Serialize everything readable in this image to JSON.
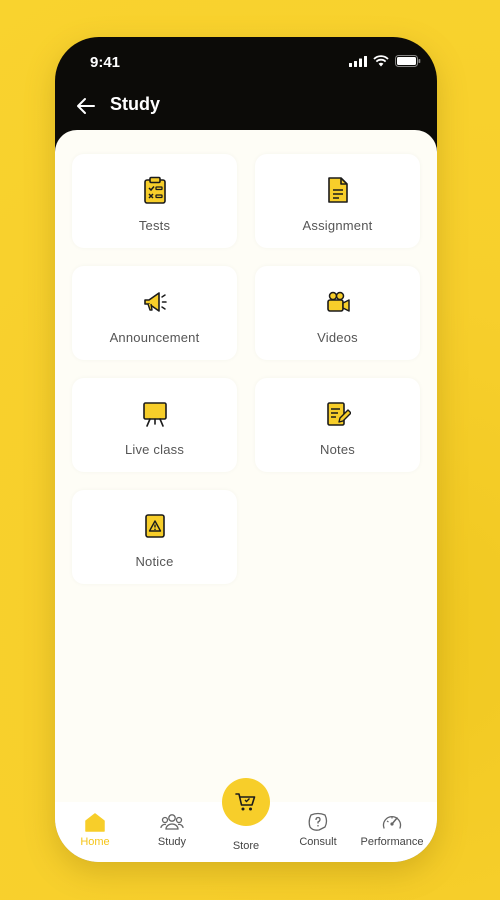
{
  "status_bar": {
    "time": "9:41"
  },
  "header": {
    "title": "Study"
  },
  "cards": [
    {
      "label": "Tests",
      "icon": "clipboard-checklist-icon"
    },
    {
      "label": "Assignment",
      "icon": "document-icon"
    },
    {
      "label": "Announcement",
      "icon": "megaphone-icon"
    },
    {
      "label": "Videos",
      "icon": "video-camera-icon"
    },
    {
      "label": "Live class",
      "icon": "easel-board-icon"
    },
    {
      "label": "Notes",
      "icon": "notes-pencil-icon"
    },
    {
      "label": "Notice",
      "icon": "warning-notice-icon"
    }
  ],
  "nav": {
    "home": "Home",
    "study": "Study",
    "store": "Store",
    "consult": "Consult",
    "performance": "Performance"
  },
  "colors": {
    "accent": "#f7ce2a",
    "dark": "#0c0b08",
    "content_bg": "#fefdf6"
  }
}
